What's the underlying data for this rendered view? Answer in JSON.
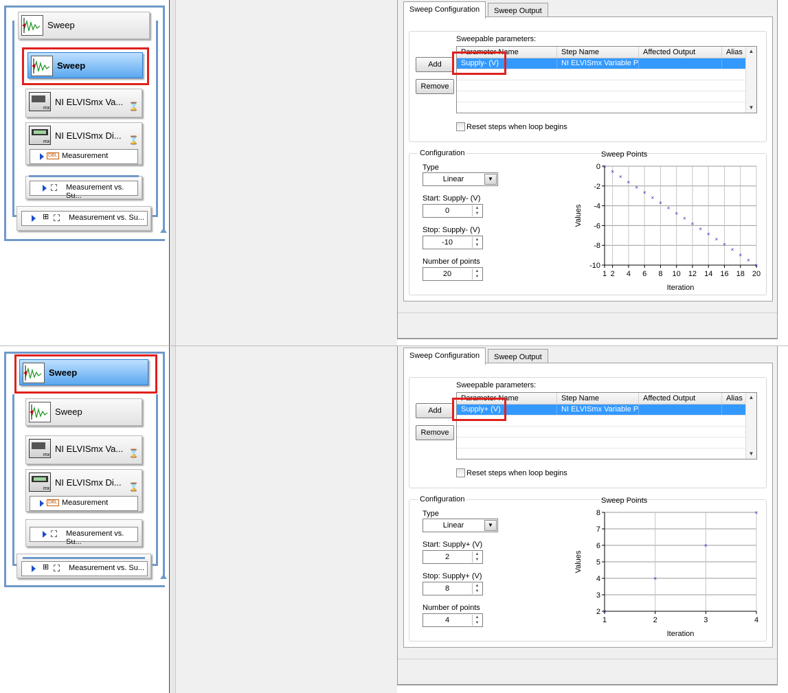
{
  "panels": [
    {
      "steps": {
        "outer_sweep": "Sweep",
        "inner_sweep": "Sweep",
        "elvis_va": "NI ELVISmx Va...",
        "elvis_di": "NI ELVISmx Di...",
        "measurement": "Measurement",
        "meas_vs_inner": "Measurement vs. Su...",
        "meas_vs_outer": "Measurement vs. Su...",
        "dbl_tag": "DBL"
      },
      "tabs": {
        "config": "Sweep Configuration",
        "output": "Sweep Output"
      },
      "params": {
        "title": "Sweepable parameters:",
        "add": "Add",
        "remove": "Remove",
        "headers": [
          "Parameter Name",
          "Step Name",
          "Affected Output",
          "Alias"
        ],
        "row": [
          "Supply- (V)",
          "NI ELVISmx Variable Pov",
          "",
          ""
        ],
        "reset_label": "Reset steps when loop begins"
      },
      "config": {
        "title": "Configuration",
        "type_label": "Type",
        "type_value": "Linear",
        "start_label": "Start: Supply- (V)",
        "start_value": "0",
        "stop_label": "Stop: Supply- (V)",
        "stop_value": "-10",
        "points_label": "Number of points",
        "points_value": "20"
      },
      "chart_data": {
        "type": "scatter",
        "title": "Sweep Points",
        "xlabel": "Iteration",
        "ylabel": "Values",
        "xlim": [
          1,
          20
        ],
        "ylim": [
          -10,
          0
        ],
        "xticks": [
          "1",
          "2",
          "4",
          "6",
          "8",
          "10",
          "12",
          "14",
          "16",
          "18",
          "20"
        ],
        "yticks": [
          "0",
          "-2",
          "-4",
          "-6",
          "-8",
          "-10"
        ],
        "x": [
          1,
          2,
          3,
          4,
          5,
          6,
          7,
          8,
          9,
          10,
          11,
          12,
          13,
          14,
          15,
          16,
          17,
          18,
          19,
          20
        ],
        "y": [
          0,
          -0.53,
          -1.05,
          -1.58,
          -2.11,
          -2.63,
          -3.16,
          -3.68,
          -4.21,
          -4.74,
          -5.26,
          -5.79,
          -6.32,
          -6.84,
          -7.37,
          -7.89,
          -8.42,
          -8.95,
          -9.47,
          -10
        ],
        "grid": true
      }
    },
    {
      "steps": {
        "outer_sweep": "Sweep",
        "inner_sweep": "Sweep",
        "elvis_va": "NI ELVISmx Va...",
        "elvis_di": "NI ELVISmx Di...",
        "measurement": "Measurement",
        "meas_vs_inner": "Measurement vs. Su...",
        "meas_vs_outer": "Measurement vs. Su...",
        "dbl_tag": "DBL"
      },
      "tabs": {
        "config": "Sweep Configuration",
        "output": "Sweep Output"
      },
      "params": {
        "title": "Sweepable parameters:",
        "add": "Add",
        "remove": "Remove",
        "headers": [
          "Parameter Name",
          "Step Name",
          "Affected Output",
          "Alias"
        ],
        "row": [
          "Supply+ (V)",
          "NI ELVISmx Variable Pov",
          "",
          ""
        ],
        "reset_label": "Reset steps when loop begins"
      },
      "config": {
        "title": "Configuration",
        "type_label": "Type",
        "type_value": "Linear",
        "start_label": "Start: Supply+ (V)",
        "start_value": "2",
        "stop_label": "Stop: Supply+ (V)",
        "stop_value": "8",
        "points_label": "Number of points",
        "points_value": "4"
      },
      "chart_data": {
        "type": "scatter",
        "title": "Sweep Points",
        "xlabel": "Iteration",
        "ylabel": "Values",
        "xlim": [
          1,
          4
        ],
        "ylim": [
          2,
          8
        ],
        "xticks": [
          "1",
          "2",
          "3",
          "4"
        ],
        "yticks": [
          "8",
          "7",
          "6",
          "5",
          "4",
          "3",
          "2"
        ],
        "x": [
          1,
          2,
          3,
          4
        ],
        "y": [
          2,
          4,
          6,
          8
        ],
        "grid": true
      }
    }
  ]
}
